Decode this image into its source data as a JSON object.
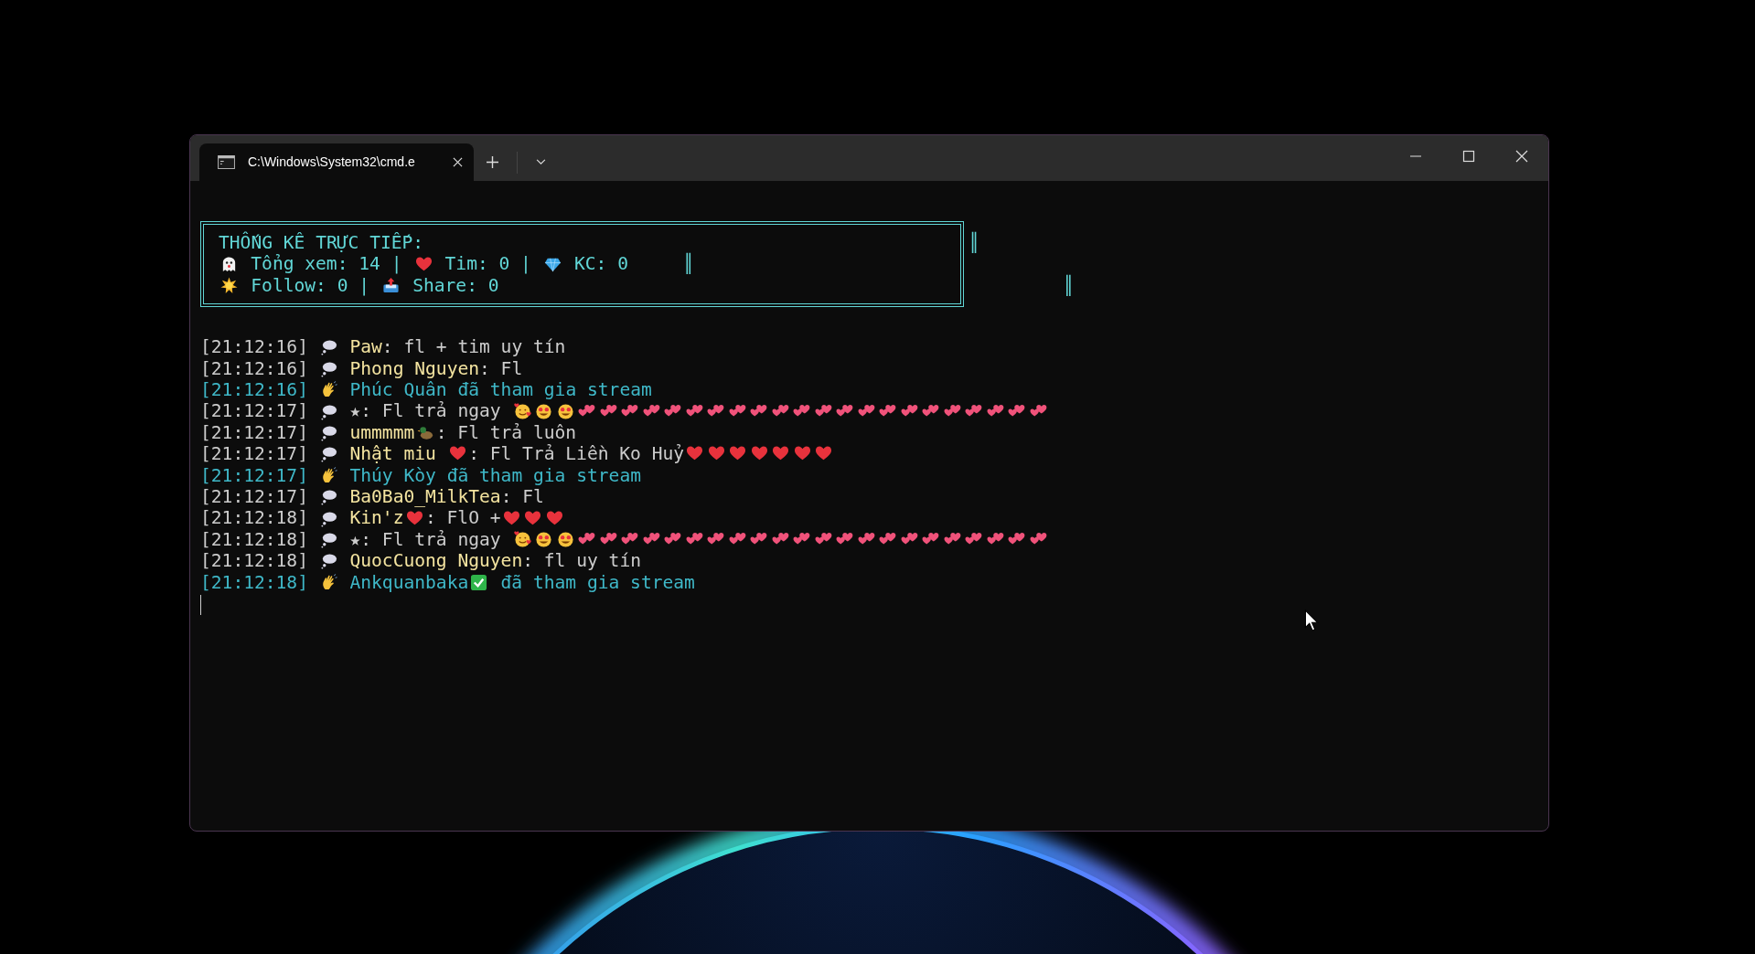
{
  "window": {
    "tab": {
      "title": "C:\\Windows\\System32\\cmd.e",
      "selected": true
    }
  },
  "stats": {
    "lines": [
      {
        "parts": [
          {
            "kind": "text",
            "text": "THỐNG KÊ TRỰC TIẾP:"
          }
        ],
        "edge": "║"
      },
      {
        "parts": [
          {
            "kind": "ghost"
          },
          {
            "kind": "text",
            "text": " Tổng xem: 14 | "
          },
          {
            "kind": "heart"
          },
          {
            "kind": "text",
            "text": " Tim: 0 | "
          },
          {
            "kind": "diamond"
          },
          {
            "kind": "text",
            "text": " KC: 0"
          }
        ],
        "edge": "║"
      },
      {
        "parts": [
          {
            "kind": "sun"
          },
          {
            "kind": "text",
            "text": " Follow: 0 | "
          },
          {
            "kind": "outbox"
          },
          {
            "kind": "text",
            "text": " Share: 0"
          }
        ],
        "edge": "║"
      }
    ]
  },
  "messages": [
    {
      "kind": "chat",
      "time": "[21:12:16]",
      "user": [
        {
          "kind": "text",
          "text": "Paw"
        }
      ],
      "body": [
        {
          "kind": "text",
          "text": ": fl + tim uy tín"
        }
      ]
    },
    {
      "kind": "chat",
      "time": "[21:12:16]",
      "user": [
        {
          "kind": "text",
          "text": "Phong Nguyen"
        }
      ],
      "body": [
        {
          "kind": "text",
          "text": ": Fl"
        }
      ]
    },
    {
      "kind": "join",
      "time": "[21:12:16]",
      "user": [
        {
          "kind": "text",
          "text": "Phúc Quân"
        }
      ],
      "body": [
        {
          "kind": "text",
          "text": " đã tham gia stream"
        }
      ]
    },
    {
      "kind": "chat",
      "time": "[21:12:17]",
      "body": [
        {
          "kind": "text",
          "text": "★: Fl trả ngay "
        },
        {
          "kind": "smiling-hearts"
        },
        {
          "kind": "star-eyes"
        },
        {
          "kind": "star-eyes"
        },
        {
          "kind": "twin-hearts"
        },
        {
          "kind": "twin-hearts"
        },
        {
          "kind": "twin-hearts"
        },
        {
          "kind": "twin-hearts"
        },
        {
          "kind": "twin-hearts"
        },
        {
          "kind": "twin-hearts"
        },
        {
          "kind": "twin-hearts"
        },
        {
          "kind": "twin-hearts"
        },
        {
          "kind": "twin-hearts"
        },
        {
          "kind": "twin-hearts"
        },
        {
          "kind": "twin-hearts"
        },
        {
          "kind": "twin-hearts"
        },
        {
          "kind": "twin-hearts"
        },
        {
          "kind": "twin-hearts"
        },
        {
          "kind": "twin-hearts"
        },
        {
          "kind": "twin-hearts"
        },
        {
          "kind": "twin-hearts"
        },
        {
          "kind": "twin-hearts"
        },
        {
          "kind": "twin-hearts"
        },
        {
          "kind": "twin-hearts"
        },
        {
          "kind": "twin-hearts"
        },
        {
          "kind": "twin-hearts"
        }
      ]
    },
    {
      "kind": "chat",
      "time": "[21:12:17]",
      "user": [
        {
          "kind": "text",
          "text": "ummmmm"
        },
        {
          "kind": "duck"
        }
      ],
      "body": [
        {
          "kind": "text",
          "text": ": Fl trả luôn"
        }
      ]
    },
    {
      "kind": "chat",
      "time": "[21:12:17]",
      "user": [
        {
          "kind": "text",
          "text": "Nhật miu "
        },
        {
          "kind": "heart"
        }
      ],
      "body": [
        {
          "kind": "text",
          "text": ": Fl Trả Liền Ko Huỷ"
        },
        {
          "kind": "heart"
        },
        {
          "kind": "heart"
        },
        {
          "kind": "heart"
        },
        {
          "kind": "heart"
        },
        {
          "kind": "heart"
        },
        {
          "kind": "heart"
        },
        {
          "kind": "heart"
        }
      ]
    },
    {
      "kind": "join",
      "time": "[21:12:17]",
      "user": [
        {
          "kind": "text",
          "text": "Thúy Kòy"
        }
      ],
      "body": [
        {
          "kind": "text",
          "text": " đã tham gia stream"
        }
      ]
    },
    {
      "kind": "chat",
      "time": "[21:12:17]",
      "user": [
        {
          "kind": "text",
          "text": "Ba0Ba0_MilkTea"
        }
      ],
      "body": [
        {
          "kind": "text",
          "text": ": Fl"
        }
      ]
    },
    {
      "kind": "chat",
      "time": "[21:12:18]",
      "user": [
        {
          "kind": "text",
          "text": "Kin'z"
        },
        {
          "kind": "heart"
        }
      ],
      "body": [
        {
          "kind": "text",
          "text": ": FlO +"
        },
        {
          "kind": "heart"
        },
        {
          "kind": "heart"
        },
        {
          "kind": "heart"
        }
      ]
    },
    {
      "kind": "chat",
      "time": "[21:12:18]",
      "body": [
        {
          "kind": "text",
          "text": "★: Fl trả ngay "
        },
        {
          "kind": "smiling-hearts"
        },
        {
          "kind": "star-eyes"
        },
        {
          "kind": "star-eyes"
        },
        {
          "kind": "twin-hearts"
        },
        {
          "kind": "twin-hearts"
        },
        {
          "kind": "twin-hearts"
        },
        {
          "kind": "twin-hearts"
        },
        {
          "kind": "twin-hearts"
        },
        {
          "kind": "twin-hearts"
        },
        {
          "kind": "twin-hearts"
        },
        {
          "kind": "twin-hearts"
        },
        {
          "kind": "twin-hearts"
        },
        {
          "kind": "twin-hearts"
        },
        {
          "kind": "twin-hearts"
        },
        {
          "kind": "twin-hearts"
        },
        {
          "kind": "twin-hearts"
        },
        {
          "kind": "twin-hearts"
        },
        {
          "kind": "twin-hearts"
        },
        {
          "kind": "twin-hearts"
        },
        {
          "kind": "twin-hearts"
        },
        {
          "kind": "twin-hearts"
        },
        {
          "kind": "twin-hearts"
        },
        {
          "kind": "twin-hearts"
        },
        {
          "kind": "twin-hearts"
        },
        {
          "kind": "twin-hearts"
        }
      ]
    },
    {
      "kind": "chat",
      "time": "[21:12:18]",
      "user": [
        {
          "kind": "text",
          "text": "QuocCuong Nguyen"
        }
      ],
      "body": [
        {
          "kind": "text",
          "text": ": fl uy tín"
        }
      ]
    },
    {
      "kind": "join",
      "time": "[21:12:18]",
      "user": [
        {
          "kind": "text",
          "text": "Ankquanbaka"
        },
        {
          "kind": "check"
        }
      ],
      "body": [
        {
          "kind": "text",
          "text": " đã tham gia stream"
        }
      ]
    }
  ]
}
